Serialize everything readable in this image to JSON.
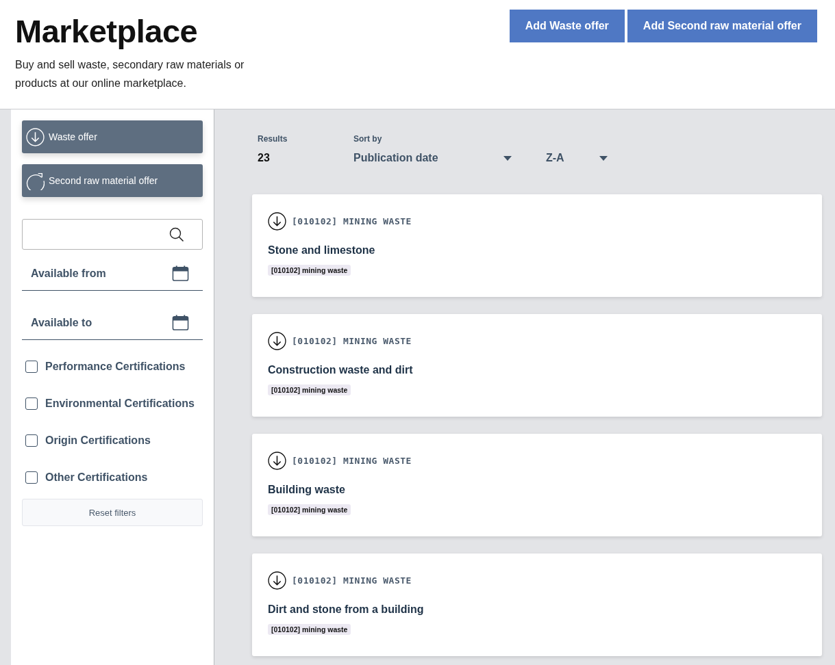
{
  "header": {
    "title": "Marketplace",
    "subtitle": "Buy and sell waste, secondary raw materials or products at our online marketplace.",
    "buttons": [
      "Add Waste offer",
      "Add Second raw material offer"
    ]
  },
  "sidebar": {
    "offer_types": [
      {
        "label": "Waste offer",
        "kind": "waste"
      },
      {
        "label": "Second raw material offer",
        "kind": "material"
      }
    ],
    "date_fields": [
      {
        "label": "Available from"
      },
      {
        "label": "Available to"
      }
    ],
    "checkboxes": [
      {
        "label": "Performance Certifications",
        "checked": false
      },
      {
        "label": "Environmental Certifications",
        "checked": false
      },
      {
        "label": "Origin Certifications",
        "checked": false
      },
      {
        "label": "Other Certifications",
        "checked": false
      }
    ],
    "reset_button": "Reset filters"
  },
  "toolbar": {
    "results_label": "Results",
    "results_count": "23",
    "sort_label": "Sort by",
    "sort_field": "Publication date",
    "sort_order": "Z-A"
  },
  "offers": [
    {
      "kind": "waste",
      "category": "[010102] MINING WASTE",
      "title": "Stone and limestone",
      "tag": "[010102] mining waste"
    },
    {
      "kind": "waste",
      "category": "[010102] MINING WASTE",
      "title": "Construction waste and dirt",
      "tag": "[010102] mining waste"
    },
    {
      "kind": "waste",
      "category": "[010102] MINING WASTE",
      "title": "Building waste",
      "tag": "[010102] mining waste"
    },
    {
      "kind": "waste",
      "category": "[010102] MINING WASTE",
      "title": "Dirt and stone from a building",
      "tag": "[010102] mining waste"
    }
  ]
}
